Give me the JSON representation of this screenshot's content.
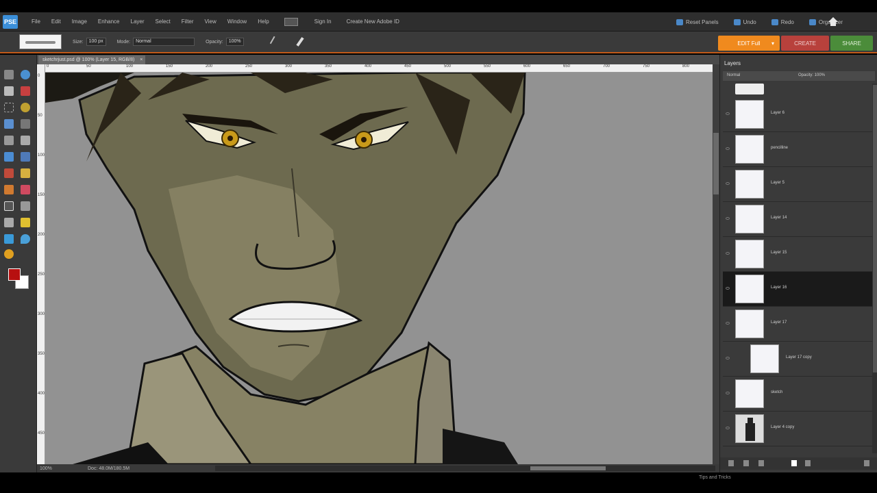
{
  "app": {
    "logo": "PSE"
  },
  "menu": {
    "items": [
      "File",
      "Edit",
      "Image",
      "Enhance",
      "Layer",
      "Select",
      "Filter",
      "View",
      "Window",
      "Help"
    ],
    "signin": "Sign In",
    "create_id": "Create New Adobe ID",
    "right": [
      "Reset Panels",
      "Undo",
      "Redo",
      "Organizer"
    ]
  },
  "options": {
    "size_label": "Size:",
    "size_value": "100 px",
    "mode_label": "Mode:",
    "mode_value": "Normal",
    "opacity_label": "Opacity:",
    "opacity_value": "100%"
  },
  "buttons": {
    "edit": "EDIT Full",
    "create": "CREATE",
    "share": "SHARE"
  },
  "document": {
    "tab": "sketchrjust.psd @ 100% (Layer 15, RGB/8)"
  },
  "rulers": {
    "top": [
      "0",
      "50",
      "100",
      "150",
      "200",
      "250",
      "300",
      "350",
      "400",
      "450",
      "500",
      "550",
      "600",
      "650",
      "700",
      "750",
      "800"
    ],
    "left": [
      "0",
      "50",
      "100",
      "150",
      "200",
      "250",
      "300",
      "350",
      "400",
      "450"
    ]
  },
  "status": {
    "zoom": "100%",
    "doc": "Doc: 48.0M/180.5M"
  },
  "layers_panel": {
    "tab": "Layers",
    "blend": "Normal",
    "opacity": "Opacity: 100%",
    "layers": [
      {
        "name": "Layer 6",
        "selected": false,
        "indent": false
      },
      {
        "name": "pencilline",
        "selected": false,
        "indent": false
      },
      {
        "name": "Layer 5",
        "selected": false,
        "indent": false
      },
      {
        "name": "Layer 14",
        "selected": false,
        "indent": false
      },
      {
        "name": "Layer 15",
        "selected": false,
        "indent": false
      },
      {
        "name": "Layer 16",
        "selected": true,
        "indent": false
      },
      {
        "name": "Layer 17",
        "selected": false,
        "indent": false
      },
      {
        "name": "Layer 17 copy",
        "selected": false,
        "indent": true
      },
      {
        "name": "sketch",
        "selected": false,
        "indent": false
      },
      {
        "name": "Layer 4 copy",
        "selected": false,
        "indent": false
      }
    ]
  },
  "tips": "Tips and Tricks"
}
